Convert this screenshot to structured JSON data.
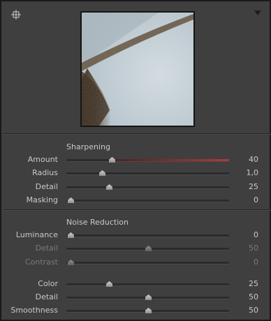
{
  "sharpening": {
    "title": "Sharpening",
    "sliders": [
      {
        "label": "Amount",
        "value": "40",
        "position": 0.28
      },
      {
        "label": "Radius",
        "value": "1,0",
        "position": 0.22
      },
      {
        "label": "Detail",
        "value": "25",
        "position": 0.25
      },
      {
        "label": "Masking",
        "value": "0",
        "position": 0.0
      }
    ]
  },
  "noise_reduction": {
    "title": "Noise Reduction",
    "luminance_sliders": [
      {
        "label": "Luminance",
        "value": "0",
        "position": 0.0
      },
      {
        "label": "Detail",
        "value": "50",
        "position": 0.5
      },
      {
        "label": "Contrast",
        "value": "0",
        "position": 0.0
      }
    ],
    "color_sliders": [
      {
        "label": "Color",
        "value": "25",
        "position": 0.25
      },
      {
        "label": "Detail",
        "value": "50",
        "position": 0.5
      },
      {
        "label": "Smoothness",
        "value": "50",
        "position": 0.5
      }
    ]
  },
  "colors": {
    "panel_bg": "#3f3f3f",
    "text": "#c9c9c9",
    "disabled_text": "#7a7a7a",
    "amount_accent": "#b03a3a"
  },
  "icons": {
    "target": "target-adjustment-icon",
    "collapse": "triangle-down-icon"
  }
}
